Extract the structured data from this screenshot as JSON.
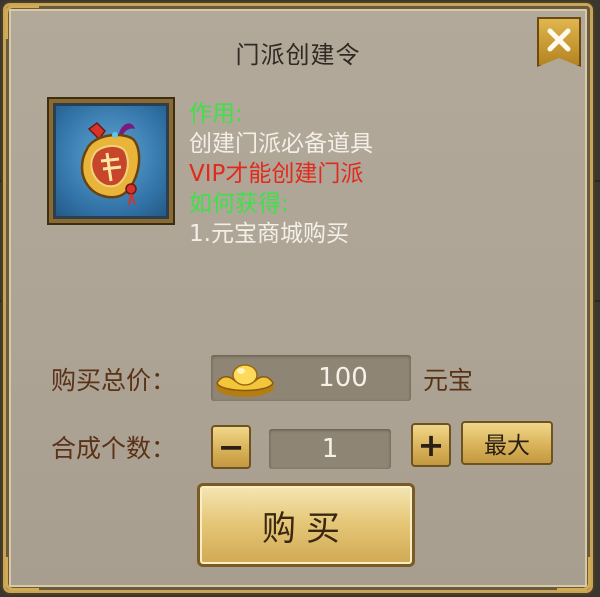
{
  "dialog": {
    "title": "门派创建令",
    "close_icon": "close-x-icon"
  },
  "item": {
    "icon": "guild-token-icon",
    "usage_heading": "作用:",
    "usage_text": "创建门派必备道具",
    "requirement_text": "VIP才能创建门派",
    "obtain_heading": "如何获得:",
    "obtain_text": "1.元宝商城购买"
  },
  "purchase": {
    "total_price_label": "购买总价：",
    "currency_icon": "gold-ingot-icon",
    "total_price_value": "100",
    "currency_unit": "元宝",
    "quantity_label": "合成个数：",
    "decrease_label": "−",
    "quantity_value": "1",
    "increase_label": "+",
    "max_label": "最大",
    "buy_label": "购买"
  },
  "colors": {
    "heading_green": "#3fe04a",
    "warning_red": "#e02b1c",
    "label_brown": "#5a3216",
    "panel_bg": "#afa597",
    "gold": "#d9b35a"
  }
}
